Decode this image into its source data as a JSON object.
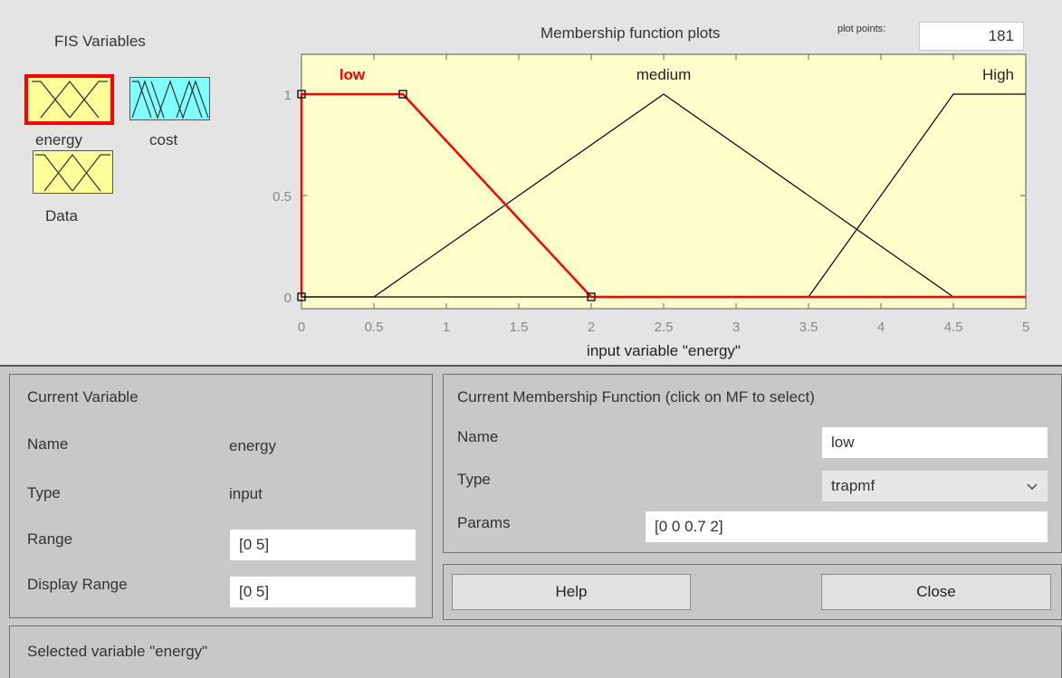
{
  "fis": {
    "title": "FIS Variables",
    "variables": [
      {
        "name": "energy",
        "kind": "input",
        "selected": true,
        "color": "#ffff99"
      },
      {
        "name": "cost",
        "kind": "output",
        "selected": false,
        "color": "#80ffff"
      },
      {
        "name": "Data",
        "kind": "input",
        "selected": false,
        "color": "#ffff99"
      }
    ]
  },
  "plot": {
    "title": "Membership function plots",
    "plot_points_label": "plot points:",
    "plot_points_value": "181"
  },
  "chart_data": {
    "type": "line",
    "xlabel": "input variable \"energy\"",
    "ylabel": "",
    "xlim": [
      0,
      5
    ],
    "ylim": [
      0,
      1
    ],
    "x_ticks": [
      0,
      0.5,
      1,
      1.5,
      2,
      2.5,
      3,
      3.5,
      4,
      4.5,
      5
    ],
    "x_tick_labels": [
      "0",
      "0.5",
      "1",
      "1.5",
      "2",
      "2.5",
      "3",
      "3.5",
      "4",
      "4.5",
      "5"
    ],
    "y_ticks": [
      0,
      0.5,
      1
    ],
    "y_tick_labels": [
      "0",
      "0.5",
      "1"
    ],
    "background": "#ffffcc",
    "series": [
      {
        "name": "low",
        "color": "#ff0000",
        "selected": true,
        "x": [
          0,
          0,
          0.7,
          2,
          5
        ],
        "y": [
          0,
          1,
          1,
          0,
          0
        ]
      },
      {
        "name": "medium",
        "color": "#000000",
        "selected": false,
        "x": [
          0,
          0.5,
          2.5,
          4.5,
          5
        ],
        "y": [
          0,
          0,
          1,
          0,
          0
        ]
      },
      {
        "name": "High",
        "color": "#000000",
        "selected": false,
        "x": [
          0,
          3.5,
          4.5,
          5
        ],
        "y": [
          0,
          0,
          1,
          1
        ]
      }
    ],
    "handles": [
      {
        "x": 0,
        "y": 1
      },
      {
        "x": 0.7,
        "y": 1
      },
      {
        "x": 2,
        "y": 0
      },
      {
        "x": 0,
        "y": 0
      }
    ]
  },
  "current_variable": {
    "title": "Current Variable",
    "name_label": "Name",
    "name_value": "energy",
    "type_label": "Type",
    "type_value": "input",
    "range_label": "Range",
    "range_value": "[0 5]",
    "display_range_label": "Display Range",
    "display_range_value": "[0 5]"
  },
  "current_mf": {
    "title": "Current Membership Function (click on MF to select)",
    "name_label": "Name",
    "name_value": "low",
    "type_label": "Type",
    "type_value": "trapmf",
    "params_label": "Params",
    "params_value": "[0 0 0.7 2]"
  },
  "buttons": {
    "help": "Help",
    "close": "Close"
  },
  "status": {
    "text": "Selected variable \"energy\""
  }
}
